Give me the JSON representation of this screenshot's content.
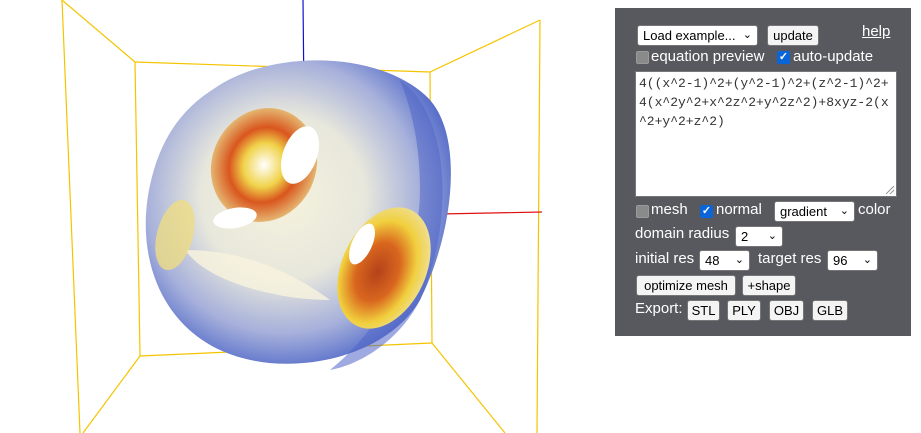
{
  "viewer": {
    "name": "3d-surface-viewport"
  },
  "panel": {
    "load_example": "Load example...",
    "update_label": "update",
    "help_label": "help",
    "equation_preview_label": "equation preview",
    "equation_preview_checked": false,
    "auto_update_label": "auto-update",
    "auto_update_checked": true,
    "equation": "4((x^2-1)^2+(y^2-1)^2+(z^2-1)^2+4(x^2y^2+x^2z^2+y^2z^2)+8xyz-2(x^2+y^2+z^2)",
    "mesh_label": "mesh",
    "mesh_checked": false,
    "normal_label": "normal",
    "normal_checked": true,
    "color_mode": "gradient",
    "color_label": "color",
    "domain_radius_label": "domain radius",
    "domain_radius_value": "2",
    "initial_res_label": "initial res",
    "initial_res_value": "48",
    "target_res_label": "target res",
    "target_res_value": "96",
    "optimize_mesh_label": "optimize mesh",
    "add_shape_label": "+shape",
    "export_label": "Export:",
    "export_buttons": [
      "STL",
      "PLY",
      "OBJ",
      "GLB"
    ]
  },
  "colors": {
    "panel_bg": "#58585f",
    "box_edges": "#f5c400",
    "axis_x": "#e01010",
    "axis_z": "#1010d0",
    "surface_blue": "#4a63c7",
    "surface_yellow": "#ecdf8a",
    "surface_orange": "#d9561e"
  }
}
